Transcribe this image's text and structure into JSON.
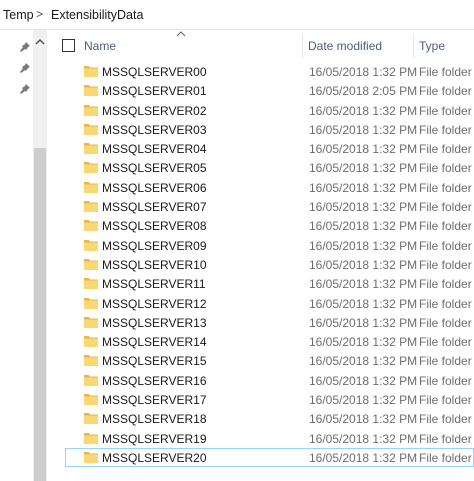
{
  "breadcrumb": {
    "items": [
      "Temp",
      "ExtensibilityData"
    ],
    "separator": ">"
  },
  "nav": {
    "pinned_icon": "pin-icon",
    "scroll_up_arrow": "^"
  },
  "columns": {
    "name": "Name",
    "date_modified": "Date modified",
    "type": "Type",
    "sort_indicator": "^"
  },
  "rows": [
    {
      "name": "MSSQLSERVER00",
      "date": "16/05/2018 1:32 PM",
      "type": "File folder"
    },
    {
      "name": "MSSQLSERVER01",
      "date": "16/05/2018 2:05 PM",
      "type": "File folder"
    },
    {
      "name": "MSSQLSERVER02",
      "date": "16/05/2018 1:32 PM",
      "type": "File folder"
    },
    {
      "name": "MSSQLSERVER03",
      "date": "16/05/2018 1:32 PM",
      "type": "File folder"
    },
    {
      "name": "MSSQLSERVER04",
      "date": "16/05/2018 1:32 PM",
      "type": "File folder"
    },
    {
      "name": "MSSQLSERVER05",
      "date": "16/05/2018 1:32 PM",
      "type": "File folder"
    },
    {
      "name": "MSSQLSERVER06",
      "date": "16/05/2018 1:32 PM",
      "type": "File folder"
    },
    {
      "name": "MSSQLSERVER07",
      "date": "16/05/2018 1:32 PM",
      "type": "File folder"
    },
    {
      "name": "MSSQLSERVER08",
      "date": "16/05/2018 1:32 PM",
      "type": "File folder"
    },
    {
      "name": "MSSQLSERVER09",
      "date": "16/05/2018 1:32 PM",
      "type": "File folder"
    },
    {
      "name": "MSSQLSERVER10",
      "date": "16/05/2018 1:32 PM",
      "type": "File folder"
    },
    {
      "name": "MSSQLSERVER11",
      "date": "16/05/2018 1:32 PM",
      "type": "File folder"
    },
    {
      "name": "MSSQLSERVER12",
      "date": "16/05/2018 1:32 PM",
      "type": "File folder"
    },
    {
      "name": "MSSQLSERVER13",
      "date": "16/05/2018 1:32 PM",
      "type": "File folder"
    },
    {
      "name": "MSSQLSERVER14",
      "date": "16/05/2018 1:32 PM",
      "type": "File folder"
    },
    {
      "name": "MSSQLSERVER15",
      "date": "16/05/2018 1:32 PM",
      "type": "File folder"
    },
    {
      "name": "MSSQLSERVER16",
      "date": "16/05/2018 1:32 PM",
      "type": "File folder"
    },
    {
      "name": "MSSQLSERVER17",
      "date": "16/05/2018 1:32 PM",
      "type": "File folder"
    },
    {
      "name": "MSSQLSERVER18",
      "date": "16/05/2018 1:32 PM",
      "type": "File folder"
    },
    {
      "name": "MSSQLSERVER19",
      "date": "16/05/2018 1:32 PM",
      "type": "File folder"
    },
    {
      "name": "MSSQLSERVER20",
      "date": "16/05/2018 1:32 PM",
      "type": "File folder",
      "selected": true
    }
  ],
  "colors": {
    "folder": "#f8d775",
    "folder_dark": "#e8b947",
    "selection_border": "#99d1ff",
    "header_text": "#4c607a",
    "secondary_text": "#6d6d6d"
  },
  "icons": {
    "folder": "folder-icon",
    "pin": "pin-icon",
    "checkbox": "checkbox-icon"
  }
}
